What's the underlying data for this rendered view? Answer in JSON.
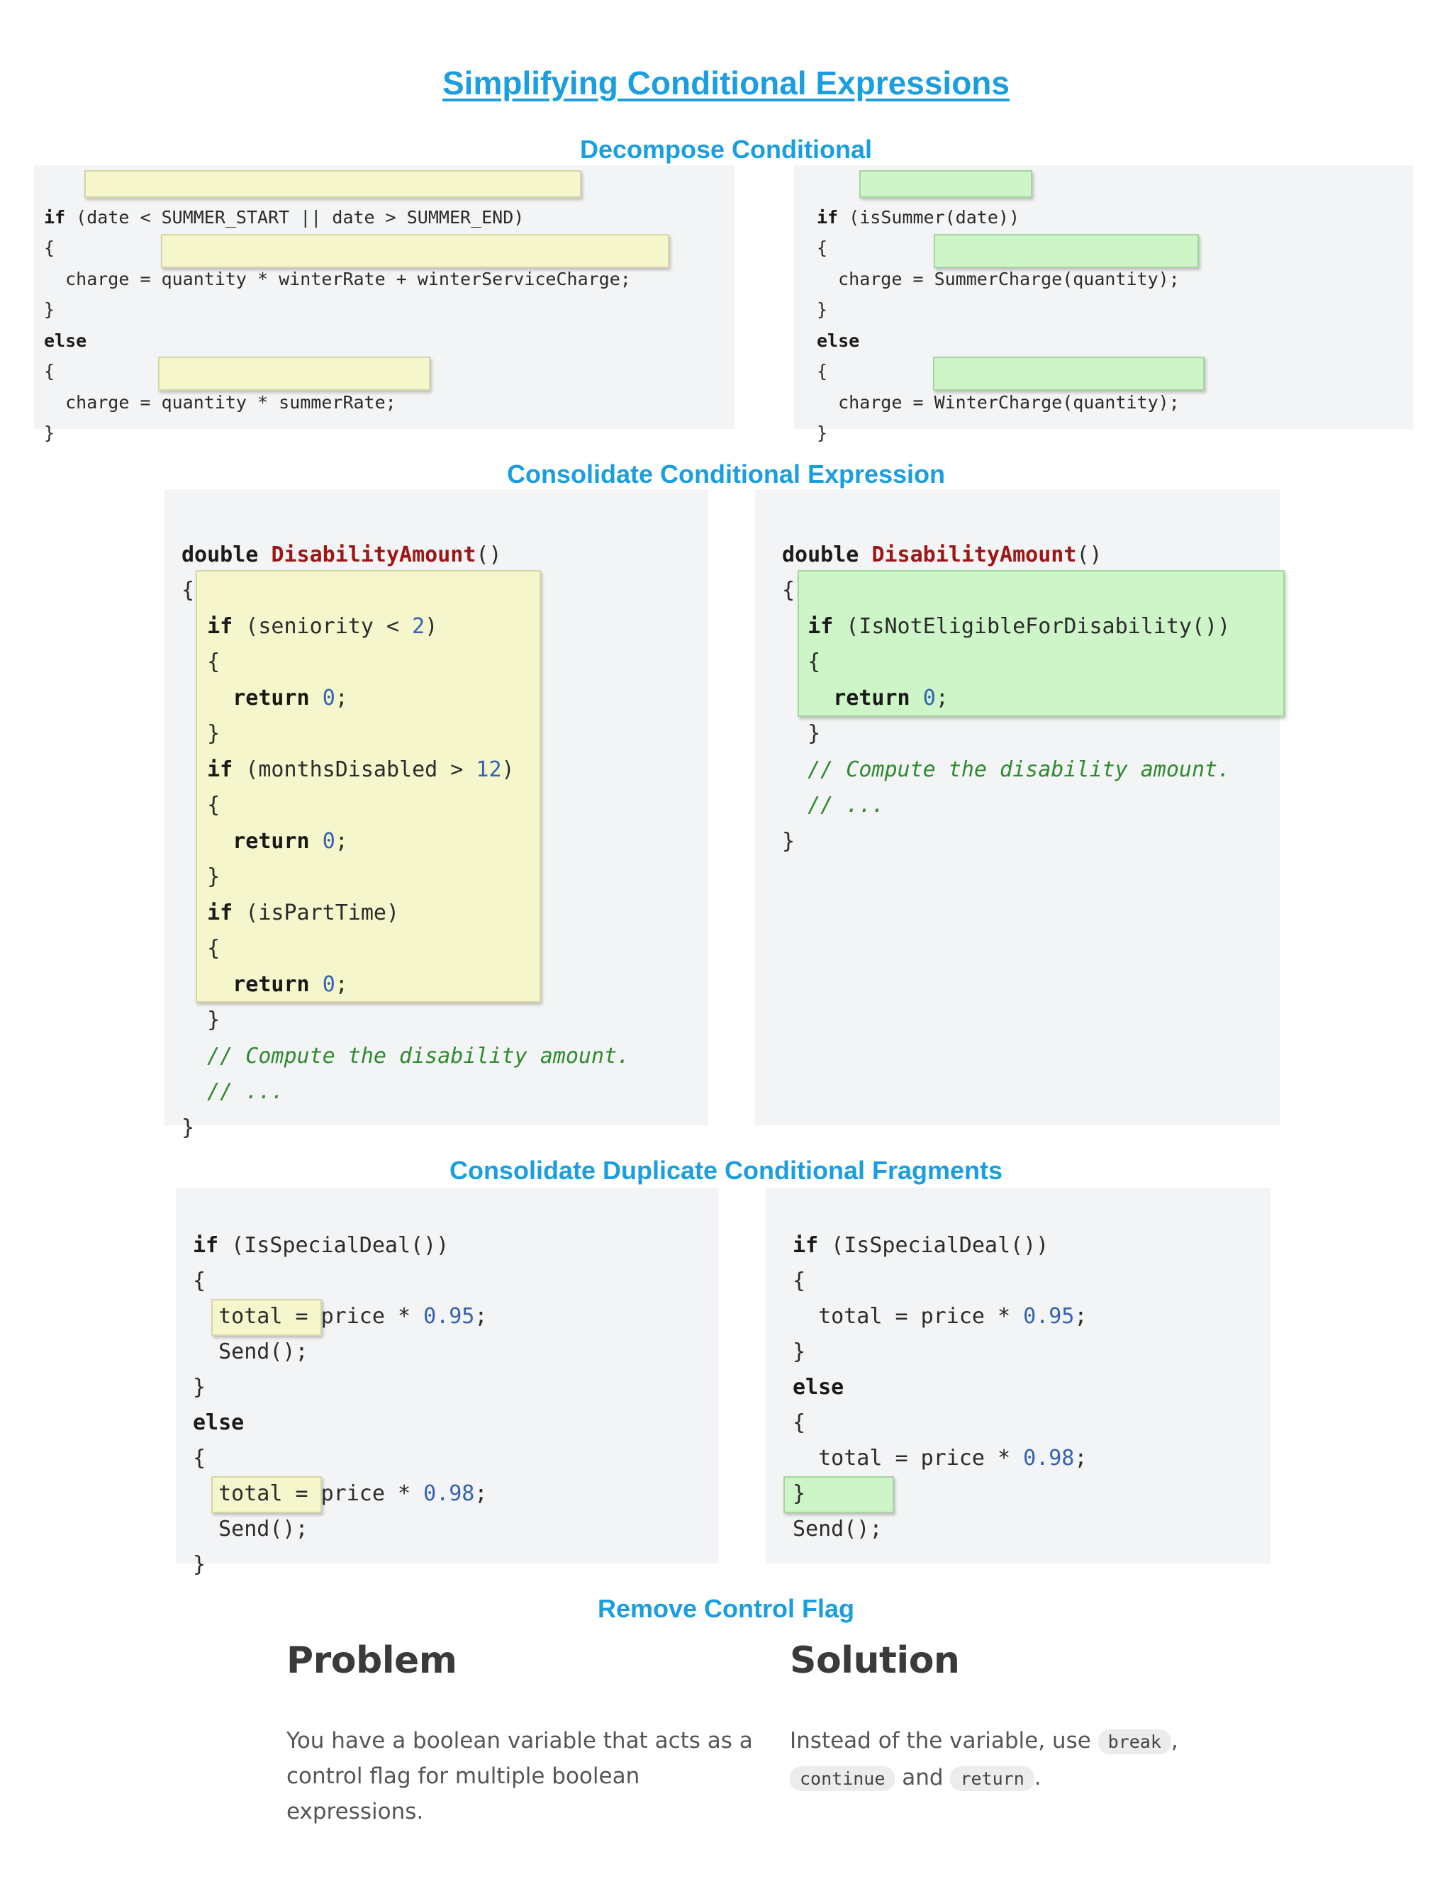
{
  "title": "Simplifying Conditional Expressions",
  "sections": {
    "decompose": {
      "title": "Decompose Conditional",
      "before": {
        "l1_kw": "if",
        "l1_open": " (",
        "l1_cond": "date < SUMMER_START || date > SUMMER_END",
        "l1_close": ")",
        "l2": "{",
        "l3_lhs": "  charge = ",
        "l3_rhs": "quantity * winterRate + winterServiceCharge;",
        "l4": "}",
        "l5_kw": "else",
        "l6": "{",
        "l7_lhs": "  charge = ",
        "l7_rhs": "quantity * summerRate;",
        "l8": "}"
      },
      "after": {
        "l1_kw": "if",
        "l1_open": " (",
        "l1_cond": "isSummer(date)",
        "l1_close": ")",
        "l2": "{",
        "l3_lhs": "  charge = ",
        "l3_rhs": "SummerCharge(quantity);",
        "l4": "}",
        "l5_kw": "else",
        "l6": "{",
        "l7_lhs": "  charge = ",
        "l7_rhs": "WinterCharge(quantity);",
        "l8": "}"
      }
    },
    "consolidate_expr": {
      "title": "Consolidate Conditional Expression",
      "before": {
        "type_kw": "double",
        "fn_name": "DisabilityAmount",
        "parens": "()",
        "brace_open": "{",
        "if1_kw": "if",
        "if1_cond": " (seniority < ",
        "if1_num": "2",
        "if1_close": ")",
        "if1_open": "{",
        "ret_kw": "return",
        "ret_num": "0",
        "semi": ";",
        "if1_end": "}",
        "if2_kw": "if",
        "if2_cond": " (monthsDisabled > ",
        "if2_num": "12",
        "if2_close": ")",
        "if2_open": "{",
        "if2_end": "}",
        "if3_kw": "if",
        "if3_cond": " (isPartTime)",
        "if3_open": "{",
        "if3_end": "}",
        "comment1": "// Compute the disability amount.",
        "comment2": "// ...",
        "brace_close": "}"
      },
      "after": {
        "type_kw": "double",
        "fn_name": "DisabilityAmount",
        "parens": "()",
        "brace_open": "{",
        "if_kw": "if",
        "if_cond": " (IsNotEligibleForDisability())",
        "if_open": "{",
        "ret_kw": "return",
        "ret_num": "0",
        "semi": ";",
        "if_end": "}",
        "comment1": "// Compute the disability amount.",
        "comment2": "// ...",
        "brace_close": "}"
      }
    },
    "duplicate_fragments": {
      "title": "Consolidate Duplicate Conditional Fragments",
      "before": {
        "if_kw": "if",
        "if_cond": " (IsSpecialDeal())",
        "open1": "{",
        "total1": "  total = price * ",
        "num1": "0.95",
        "semi": ";",
        "send1": "Send();",
        "close1": "}",
        "else_kw": "else",
        "open2": "{",
        "total2": "  total = price * ",
        "num2": "0.98",
        "send2": "Send();",
        "close2": "}"
      },
      "after": {
        "if_kw": "if",
        "if_cond": " (IsSpecialDeal())",
        "open1": "{",
        "total1": "  total = price * ",
        "num1": "0.95",
        "semi": ";",
        "close1": "}",
        "else_kw": "else",
        "open2": "{",
        "total2": "  total = price * ",
        "num2": "0.98",
        "close2": "}",
        "send": "Send();"
      }
    },
    "control_flag": {
      "title": "Remove Control Flag",
      "problem": {
        "heading": "Problem",
        "line1": "You have a boolean variable that acts as a",
        "line2": "control flag for multiple boolean expressions."
      },
      "solution": {
        "heading": "Solution",
        "text1": "Instead of the variable, use ",
        "code_break": "break",
        "comma": ",",
        "code_continue": "continue",
        "and": " and ",
        "code_return": "return",
        "period": "."
      }
    }
  }
}
